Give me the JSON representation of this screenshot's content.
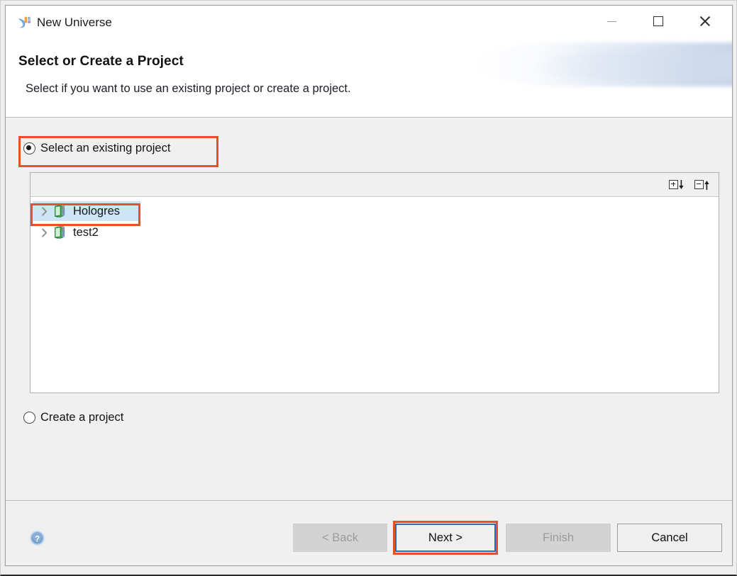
{
  "window": {
    "title": "New Universe",
    "app_icon": "universe-logo-icon",
    "controls": {
      "minimize_label": "Minimize",
      "maximize_label": "Maximize",
      "close_label": "Close"
    }
  },
  "header": {
    "title": "Select or Create a Project",
    "description": "Select if you want to use an existing project or create a project."
  },
  "options": {
    "existing": {
      "label": "Select an existing project",
      "checked": true
    },
    "create": {
      "label": "Create a project",
      "checked": false
    }
  },
  "tree_toolbar": {
    "expand_all": "expand-all-icon",
    "collapse_all": "collapse-all-icon"
  },
  "tree": {
    "items": [
      {
        "label": "Hologres",
        "selected": true,
        "expanded": false,
        "icon": "project-book-icon"
      },
      {
        "label": "test2",
        "selected": false,
        "expanded": false,
        "icon": "project-book-icon"
      }
    ]
  },
  "footer": {
    "help_icon": "help-question-icon",
    "buttons": [
      {
        "name": "back",
        "label": "< Back",
        "state": "disabled"
      },
      {
        "name": "next",
        "label": "Next >",
        "state": "focused"
      },
      {
        "name": "finish",
        "label": "Finish",
        "state": "disabled"
      },
      {
        "name": "cancel",
        "label": "Cancel",
        "state": "enabled"
      }
    ]
  },
  "annotations": {
    "highlight_color": "#e8502a",
    "highlighted": [
      "select-an-existing-project-radio",
      "tree-item-hologres",
      "next-button"
    ]
  }
}
